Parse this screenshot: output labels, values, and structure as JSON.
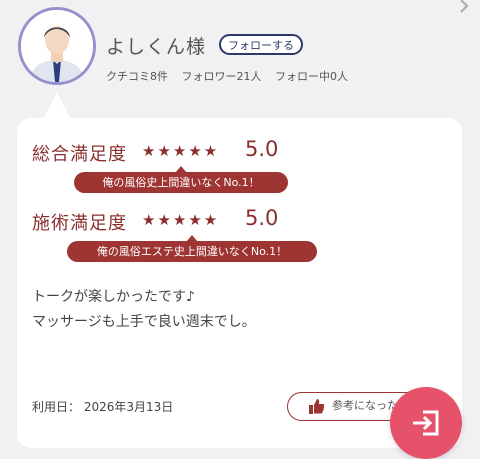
{
  "profile": {
    "name": "よしくん様",
    "follow_label": "フォローする",
    "stats": {
      "reviews": "クチコミ8件",
      "followers": "フォロワー21人",
      "following": "フォロー中0人"
    }
  },
  "ratings": [
    {
      "label": "総合満足度",
      "stars": "★★★★★",
      "score": "5.0",
      "comment": "俺の風俗史上間違いなくNo.1！"
    },
    {
      "label": "施術満足度",
      "stars": "★★★★★",
      "score": "5.0",
      "comment": "俺の風俗エステ史上間違いなくNo.1！"
    }
  ],
  "review_text": {
    "line1": "トークが楽しかったです♪",
    "line2": "マッサージも上手で良い週末でし。"
  },
  "use_date": "利用日： 2026年3月13日",
  "helpful_label": "参考になった",
  "colors": {
    "accent": "#9e3533",
    "follow_border": "#2b3a6b",
    "fab": "#e5526a",
    "avatar_ring": "#9a8fcd"
  },
  "icons": [
    "chevron-right-icon",
    "thumbs-up-icon",
    "exit-icon"
  ]
}
